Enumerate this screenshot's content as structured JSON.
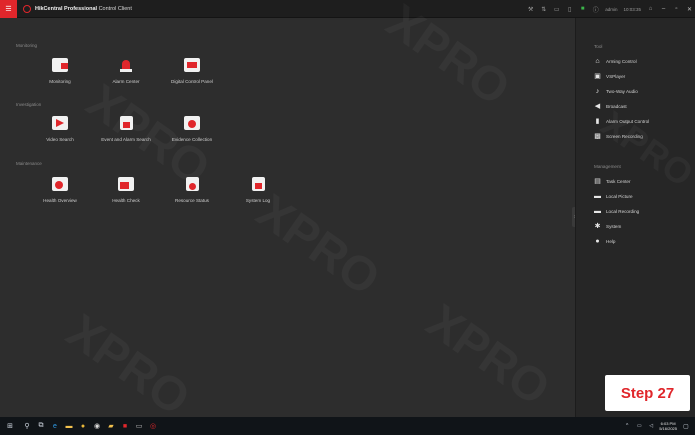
{
  "titlebar": {
    "app_name_bold": "HikCentral Professional",
    "app_name_rest": " Control Client",
    "user": "admin",
    "time": "10:03:35"
  },
  "main": {
    "sections": [
      {
        "title": "Monitoring",
        "tiles": [
          "Monitoring",
          "Alarm Center",
          "Digital Control Panel"
        ]
      },
      {
        "title": "Investigation",
        "tiles": [
          "Video Search",
          "Event and Alarm Search",
          "Evidence Collection"
        ]
      },
      {
        "title": "Maintenance",
        "tiles": [
          "Health Overview",
          "Health Check",
          "Resource Status",
          "System Log"
        ]
      }
    ]
  },
  "rpanel": {
    "tool_title": "Tool",
    "tools": [
      "Arming Control",
      "VSPlayer",
      "Two-Way Audio",
      "Broadcast",
      "Alarm Output Control",
      "Screen Recording"
    ],
    "management_title": "Management",
    "management": [
      "Task Center",
      "Local Picture",
      "Local Recording",
      "System",
      "Help"
    ]
  },
  "step_badge": "Step 27",
  "taskbar": {
    "time": "6:03 PM",
    "date": "5/16/2025"
  },
  "colors": {
    "accent": "#e0262b"
  }
}
